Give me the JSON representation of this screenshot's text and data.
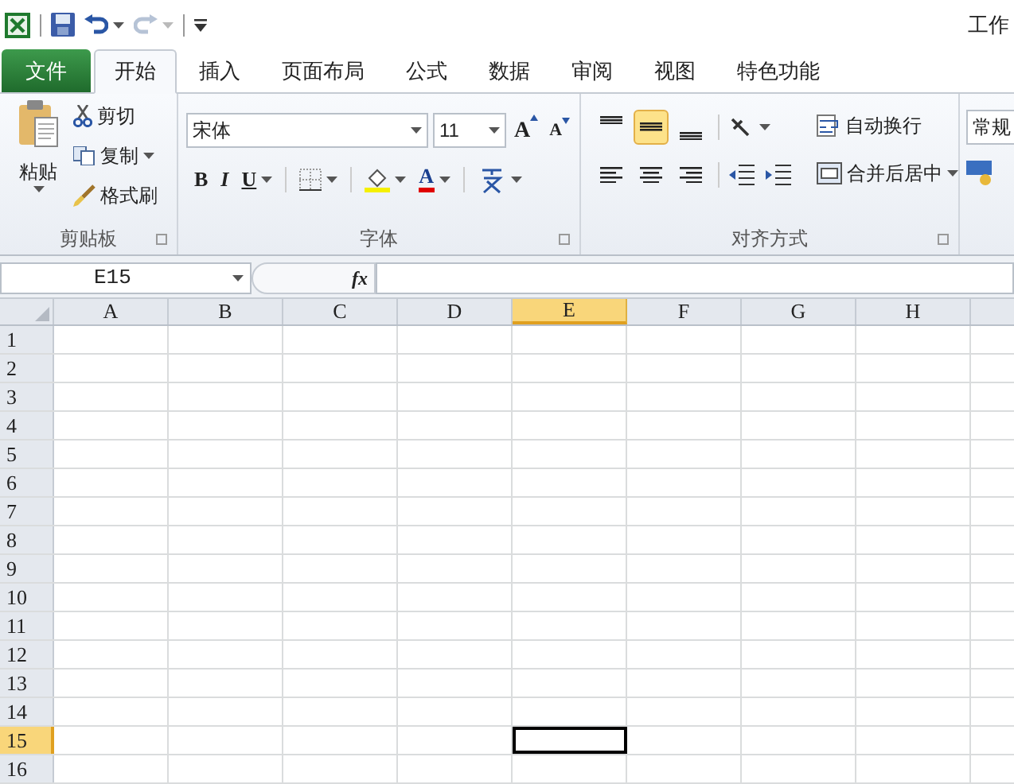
{
  "window": {
    "title": "工作"
  },
  "file_tab": "文件",
  "tabs": [
    {
      "label": "开始",
      "selected": true
    },
    {
      "label": "插入",
      "selected": false
    },
    {
      "label": "页面布局",
      "selected": false
    },
    {
      "label": "公式",
      "selected": false
    },
    {
      "label": "数据",
      "selected": false
    },
    {
      "label": "审阅",
      "selected": false
    },
    {
      "label": "视图",
      "selected": false
    },
    {
      "label": "特色功能",
      "selected": false
    }
  ],
  "clipboard": {
    "label": "剪贴板",
    "paste": "粘贴",
    "cut": "剪切",
    "copy": "复制",
    "format_painter": "格式刷"
  },
  "font": {
    "label": "字体",
    "font_name": "宋体",
    "font_size": "11",
    "grow": "A",
    "shrink": "A",
    "bold": "B",
    "italic": "I",
    "underline": "U",
    "font_color": "A"
  },
  "alignment": {
    "label": "对齐方式",
    "wrap_text": "自动换行",
    "merge_center": "合并后居中",
    "vertical": [
      {
        "kind": "top",
        "selected": false
      },
      {
        "kind": "middle",
        "selected": true
      },
      {
        "kind": "bottom",
        "selected": false
      }
    ]
  },
  "number": {
    "format": "常规"
  },
  "formula_bar": {
    "name_box": "E15",
    "fx": "fx"
  },
  "columns": [
    {
      "label": "A",
      "selected": false
    },
    {
      "label": "B",
      "selected": false
    },
    {
      "label": "C",
      "selected": false
    },
    {
      "label": "D",
      "selected": false
    },
    {
      "label": "E",
      "selected": true
    },
    {
      "label": "F",
      "selected": false
    },
    {
      "label": "G",
      "selected": false
    },
    {
      "label": "H",
      "selected": false
    }
  ],
  "rows": [
    {
      "label": "1",
      "selected": false
    },
    {
      "label": "2",
      "selected": false
    },
    {
      "label": "3",
      "selected": false
    },
    {
      "label": "4",
      "selected": false
    },
    {
      "label": "5",
      "selected": false
    },
    {
      "label": "6",
      "selected": false
    },
    {
      "label": "7",
      "selected": false
    },
    {
      "label": "8",
      "selected": false
    },
    {
      "label": "9",
      "selected": false
    },
    {
      "label": "10",
      "selected": false
    },
    {
      "label": "11",
      "selected": false
    },
    {
      "label": "12",
      "selected": false
    },
    {
      "label": "13",
      "selected": false
    },
    {
      "label": "14",
      "selected": false
    },
    {
      "label": "15",
      "selected": true
    },
    {
      "label": "16",
      "selected": false
    }
  ]
}
